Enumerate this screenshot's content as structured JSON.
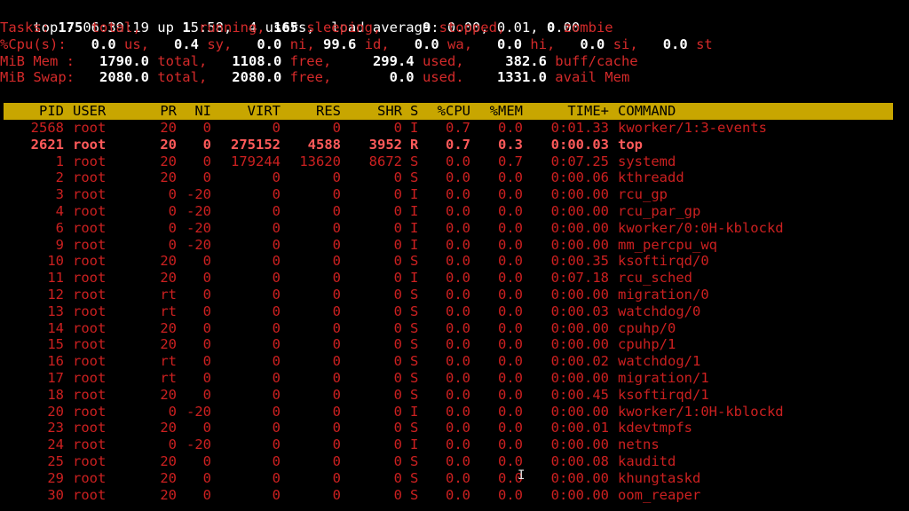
{
  "summary": {
    "top_line": "top - 06:39:19 up  5:58,  4 users,  load average: 0.00, 0.01, 0.00",
    "tasks": [
      {
        "t": "Tasks: ",
        "c": "r"
      },
      {
        "t": "175",
        "c": "wb"
      },
      {
        "t": " total,   ",
        "c": "r"
      },
      {
        "t": "  1",
        "c": "wb"
      },
      {
        "t": " running, ",
        "c": "r"
      },
      {
        "t": "165",
        "c": "wb"
      },
      {
        "t": " sleeping,   ",
        "c": "r"
      },
      {
        "t": "  9",
        "c": "wb"
      },
      {
        "t": " stopped,   ",
        "c": "r"
      },
      {
        "t": "  0",
        "c": "wb"
      },
      {
        "t": " zombie",
        "c": "r"
      }
    ],
    "cpu": [
      {
        "t": "%Cpu(s): ",
        "c": "r"
      },
      {
        "t": "  0.0",
        "c": "wb"
      },
      {
        "t": " us, ",
        "c": "r"
      },
      {
        "t": "  0.4",
        "c": "wb"
      },
      {
        "t": " sy, ",
        "c": "r"
      },
      {
        "t": "  0.0",
        "c": "wb"
      },
      {
        "t": " ni, ",
        "c": "r"
      },
      {
        "t": "99.6",
        "c": "wb"
      },
      {
        "t": " id, ",
        "c": "r"
      },
      {
        "t": "  0.0",
        "c": "wb"
      },
      {
        "t": " wa, ",
        "c": "r"
      },
      {
        "t": "  0.0",
        "c": "wb"
      },
      {
        "t": " hi, ",
        "c": "r"
      },
      {
        "t": "  0.0",
        "c": "wb"
      },
      {
        "t": " si, ",
        "c": "r"
      },
      {
        "t": "  0.0",
        "c": "wb"
      },
      {
        "t": " st",
        "c": "r"
      }
    ],
    "mem": [
      {
        "t": "MiB Mem : ",
        "c": "r"
      },
      {
        "t": "  1790.0",
        "c": "wb"
      },
      {
        "t": " total, ",
        "c": "r"
      },
      {
        "t": "  1108.0",
        "c": "wb"
      },
      {
        "t": " free, ",
        "c": "r"
      },
      {
        "t": "    299.4",
        "c": "wb"
      },
      {
        "t": " used, ",
        "c": "r"
      },
      {
        "t": "    382.6",
        "c": "wb"
      },
      {
        "t": " buff/cache",
        "c": "r"
      }
    ],
    "swap": [
      {
        "t": "MiB Swap: ",
        "c": "r"
      },
      {
        "t": "  2080.0",
        "c": "wb"
      },
      {
        "t": " total, ",
        "c": "r"
      },
      {
        "t": "  2080.0",
        "c": "wb"
      },
      {
        "t": " free, ",
        "c": "r"
      },
      {
        "t": "      0.0",
        "c": "wb"
      },
      {
        "t": " used. ",
        "c": "r"
      },
      {
        "t": "   1331.0",
        "c": "wb"
      },
      {
        "t": " avail Mem",
        "c": "r"
      }
    ]
  },
  "table": {
    "headers": [
      "PID",
      "USER",
      "PR",
      "NI",
      "VIRT",
      "RES",
      "SHR",
      "S",
      "%CPU",
      "%MEM",
      "TIME+",
      "COMMAND"
    ],
    "rows": [
      [
        "2568",
        "root",
        "20",
        "0",
        "0",
        "0",
        "0",
        "I",
        "0.7",
        "0.0",
        "0:01.33",
        "kworker/1:3-events"
      ],
      [
        "2621",
        "root",
        "20",
        "0",
        "275152",
        "4588",
        "3952",
        "R",
        "0.7",
        "0.3",
        "0:00.03",
        "top"
      ],
      [
        "1",
        "root",
        "20",
        "0",
        "179244",
        "13620",
        "8672",
        "S",
        "0.0",
        "0.7",
        "0:07.25",
        "systemd"
      ],
      [
        "2",
        "root",
        "20",
        "0",
        "0",
        "0",
        "0",
        "S",
        "0.0",
        "0.0",
        "0:00.06",
        "kthreadd"
      ],
      [
        "3",
        "root",
        "0",
        "-20",
        "0",
        "0",
        "0",
        "I",
        "0.0",
        "0.0",
        "0:00.00",
        "rcu_gp"
      ],
      [
        "4",
        "root",
        "0",
        "-20",
        "0",
        "0",
        "0",
        "I",
        "0.0",
        "0.0",
        "0:00.00",
        "rcu_par_gp"
      ],
      [
        "6",
        "root",
        "0",
        "-20",
        "0",
        "0",
        "0",
        "I",
        "0.0",
        "0.0",
        "0:00.00",
        "kworker/0:0H-kblockd"
      ],
      [
        "9",
        "root",
        "0",
        "-20",
        "0",
        "0",
        "0",
        "I",
        "0.0",
        "0.0",
        "0:00.00",
        "mm_percpu_wq"
      ],
      [
        "10",
        "root",
        "20",
        "0",
        "0",
        "0",
        "0",
        "S",
        "0.0",
        "0.0",
        "0:00.35",
        "ksoftirqd/0"
      ],
      [
        "11",
        "root",
        "20",
        "0",
        "0",
        "0",
        "0",
        "I",
        "0.0",
        "0.0",
        "0:07.18",
        "rcu_sched"
      ],
      [
        "12",
        "root",
        "rt",
        "0",
        "0",
        "0",
        "0",
        "S",
        "0.0",
        "0.0",
        "0:00.00",
        "migration/0"
      ],
      [
        "13",
        "root",
        "rt",
        "0",
        "0",
        "0",
        "0",
        "S",
        "0.0",
        "0.0",
        "0:00.03",
        "watchdog/0"
      ],
      [
        "14",
        "root",
        "20",
        "0",
        "0",
        "0",
        "0",
        "S",
        "0.0",
        "0.0",
        "0:00.00",
        "cpuhp/0"
      ],
      [
        "15",
        "root",
        "20",
        "0",
        "0",
        "0",
        "0",
        "S",
        "0.0",
        "0.0",
        "0:00.00",
        "cpuhp/1"
      ],
      [
        "16",
        "root",
        "rt",
        "0",
        "0",
        "0",
        "0",
        "S",
        "0.0",
        "0.0",
        "0:00.02",
        "watchdog/1"
      ],
      [
        "17",
        "root",
        "rt",
        "0",
        "0",
        "0",
        "0",
        "S",
        "0.0",
        "0.0",
        "0:00.00",
        "migration/1"
      ],
      [
        "18",
        "root",
        "20",
        "0",
        "0",
        "0",
        "0",
        "S",
        "0.0",
        "0.0",
        "0:00.45",
        "ksoftirqd/1"
      ],
      [
        "20",
        "root",
        "0",
        "-20",
        "0",
        "0",
        "0",
        "I",
        "0.0",
        "0.0",
        "0:00.00",
        "kworker/1:0H-kblockd"
      ],
      [
        "23",
        "root",
        "20",
        "0",
        "0",
        "0",
        "0",
        "S",
        "0.0",
        "0.0",
        "0:00.01",
        "kdevtmpfs"
      ],
      [
        "24",
        "root",
        "0",
        "-20",
        "0",
        "0",
        "0",
        "I",
        "0.0",
        "0.0",
        "0:00.00",
        "netns"
      ],
      [
        "25",
        "root",
        "20",
        "0",
        "0",
        "0",
        "0",
        "S",
        "0.0",
        "0.0",
        "0:00.08",
        "kauditd"
      ],
      [
        "29",
        "root",
        "20",
        "0",
        "0",
        "0",
        "0",
        "S",
        "0.0",
        "0.0",
        "0:00.00",
        "khungtaskd"
      ],
      [
        "30",
        "root",
        "20",
        "0",
        "0",
        "0",
        "0",
        "S",
        "0.0",
        "0.0",
        "0:00.00",
        "oom_reaper"
      ]
    ],
    "highlighted_row_pid": "2621"
  },
  "colors": {
    "background": "#000000",
    "label_red": "#d42a2a",
    "header_bar": "#c8a600",
    "value_white": "#ffffff"
  },
  "icons": {
    "cursor": "text-cursor-icon"
  }
}
